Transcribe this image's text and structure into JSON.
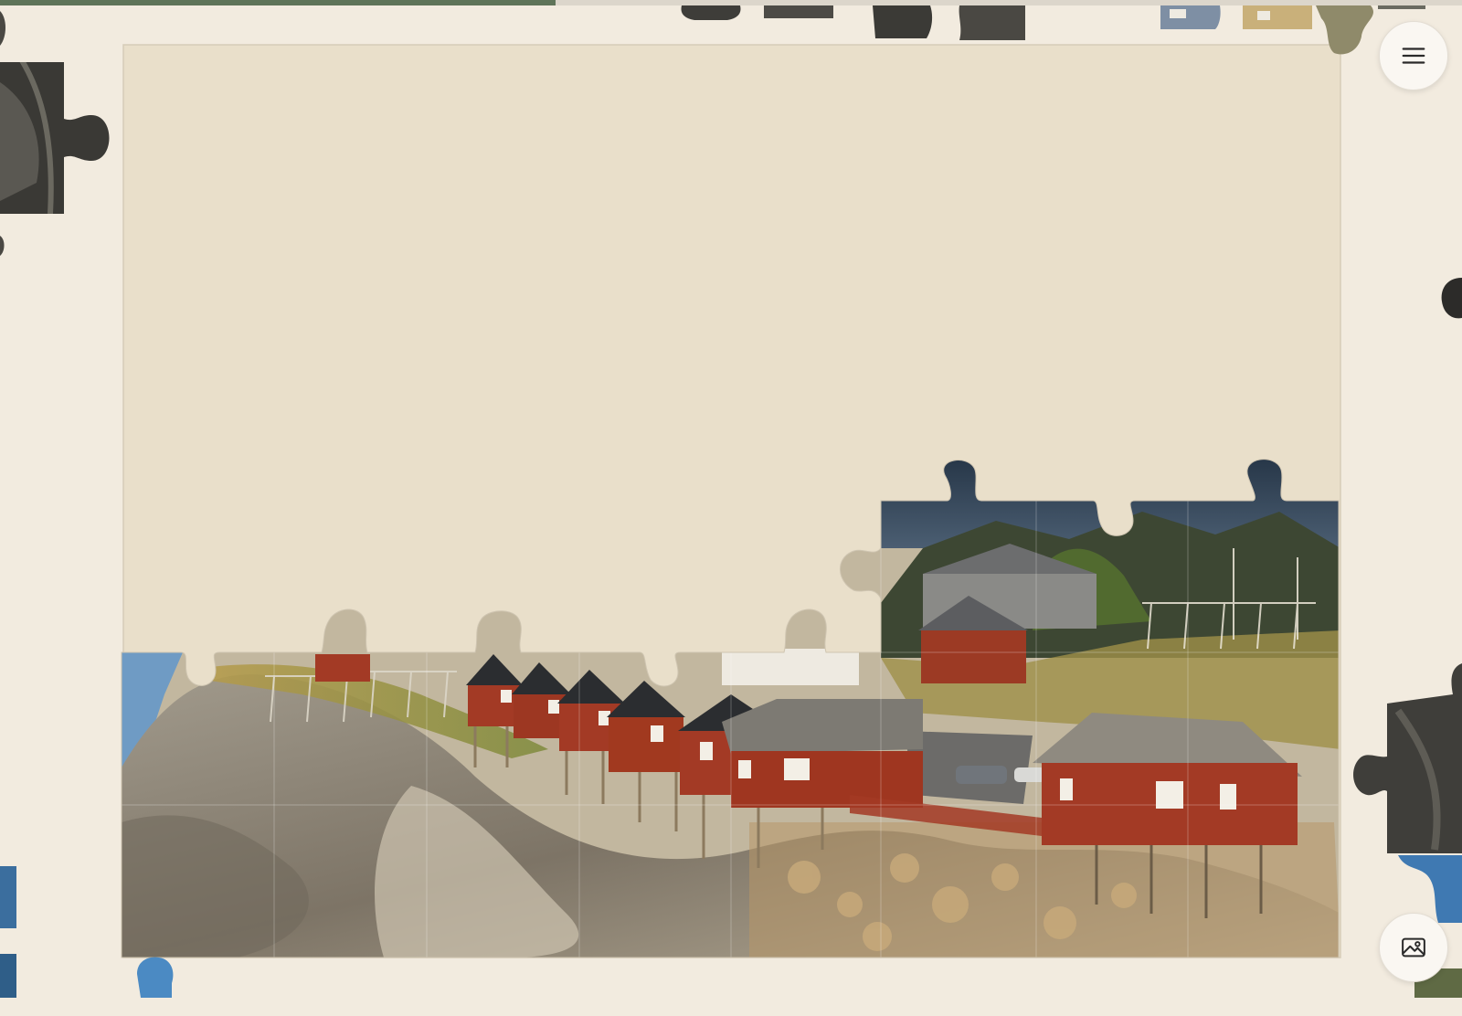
{
  "app": {
    "menu_icon": "hamburger-menu-icon",
    "preview_icon": "image-preview-icon"
  },
  "progress": {
    "fraction": 0.38
  },
  "colors": {
    "background": "#f2ebdf",
    "board": "#e9dfca",
    "progress_fill": "#5f7459",
    "progress_track": "#dcd6cb",
    "sky": "#6f9bc4",
    "sea": "#9fb6c7",
    "rock": "#8a8173",
    "grass": "#a89548",
    "hill": "#3d4733",
    "cabin_red": "#a33a25",
    "roof_dark": "#2b2d30",
    "roof_grey": "#7d7a73",
    "window": "#f3efe6"
  },
  "puzzle": {
    "grid": {
      "columns": 8,
      "rows": 6
    },
    "placed_pieces": [
      {
        "row": 4,
        "col": 0
      },
      {
        "row": 4,
        "col": 1
      },
      {
        "row": 4,
        "col": 2
      },
      {
        "row": 4,
        "col": 3
      },
      {
        "row": 4,
        "col": 4
      },
      {
        "row": 4,
        "col": 5
      },
      {
        "row": 4,
        "col": 6
      },
      {
        "row": 4,
        "col": 7
      },
      {
        "row": 5,
        "col": 0
      },
      {
        "row": 5,
        "col": 1
      },
      {
        "row": 5,
        "col": 2
      },
      {
        "row": 5,
        "col": 3
      },
      {
        "row": 5,
        "col": 4
      },
      {
        "row": 5,
        "col": 5
      },
      {
        "row": 5,
        "col": 6
      },
      {
        "row": 5,
        "col": 7
      },
      {
        "row": 3,
        "col": 5
      },
      {
        "row": 3,
        "col": 6
      },
      {
        "row": 3,
        "col": 7
      }
    ]
  }
}
